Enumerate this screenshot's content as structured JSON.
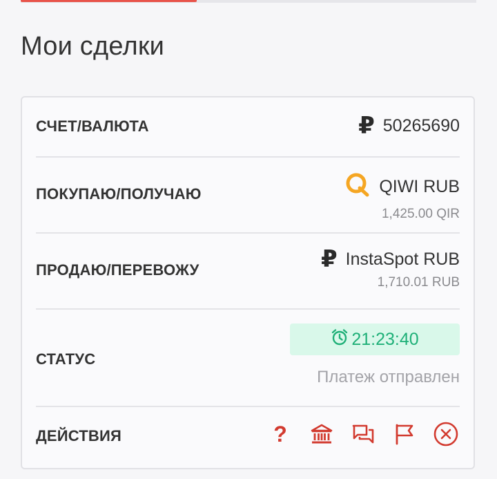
{
  "page": {
    "title": "Мои сделки"
  },
  "deal": {
    "account": {
      "label": "СЧЕТ/ВАЛЮТА",
      "currency_symbol": "₽",
      "number": "50265690"
    },
    "buy": {
      "label": "ПОКУПАЮ/ПОЛУЧАЮ",
      "method": "QIWI RUB",
      "amount": "1,425.00 QIR"
    },
    "sell": {
      "label": "ПРОДАЮ/ПЕРЕВОЖУ",
      "currency_symbol": "₽",
      "method": "InstaSpot RUB",
      "amount": "1,710.01 RUB"
    },
    "status": {
      "label": "СТАТУС",
      "timer": "21:23:40",
      "text": "Платеж отправлен"
    },
    "actions": {
      "label": "ДЕЙСТВИЯ",
      "help_symbol": "?"
    }
  },
  "colors": {
    "accent": "#e8534a",
    "action": "#d23a2f",
    "timer_bg": "#d9f8ea",
    "timer_fg": "#1fb078",
    "qiwi": "#f5a623"
  }
}
